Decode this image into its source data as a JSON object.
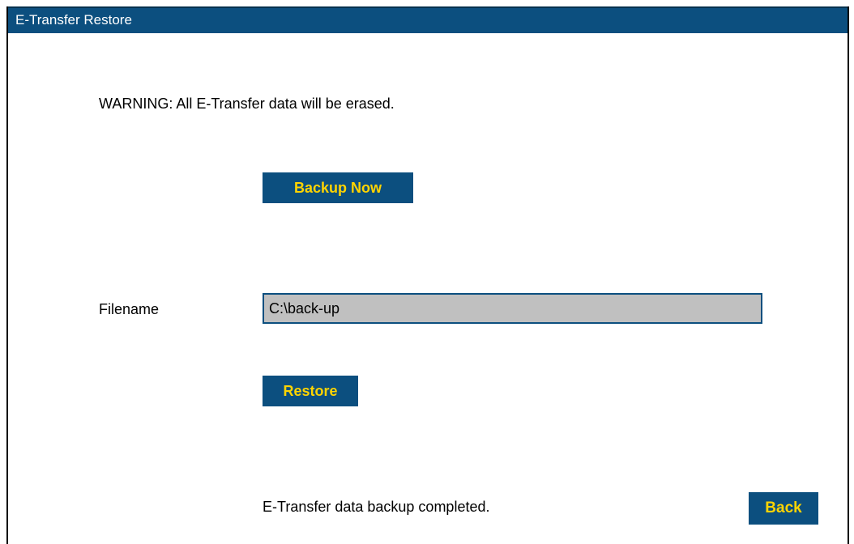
{
  "window": {
    "title": "E-Transfer Restore"
  },
  "warning": {
    "text": "WARNING: All E-Transfer data will be erased."
  },
  "backup": {
    "button_label": "Backup Now"
  },
  "filename": {
    "label": "Filename",
    "value": "C:\\back-up"
  },
  "restore": {
    "button_label": "Restore"
  },
  "status": {
    "message": "E-Transfer data backup completed."
  },
  "back": {
    "button_label": "Back"
  },
  "colors": {
    "title_bar": "#0c4f7f",
    "button_bg": "#0c4f7f",
    "button_text": "#ffd400",
    "input_bg": "#c0c0c0"
  }
}
